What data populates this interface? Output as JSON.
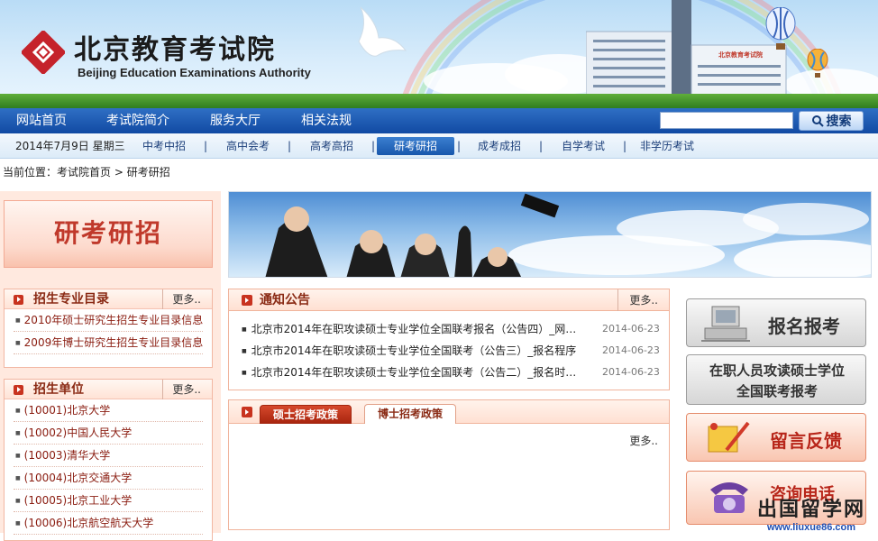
{
  "header": {
    "logo_cn": "北京教育考试院",
    "logo_en": "Beijing Education Examinations Authority",
    "building_sign": "北京教育考试院"
  },
  "main_nav": {
    "items": [
      "网站首页",
      "考试院简介",
      "服务大厅",
      "相关法规"
    ],
    "search_placeholder": "",
    "search_label": "搜索"
  },
  "sub_nav": {
    "date": "2014年7月9日 星期三",
    "items": [
      "中考中招",
      "高中会考",
      "高考高招",
      "研考研招",
      "成考成招",
      "自学考试",
      "非学历考试"
    ],
    "active_index": 3,
    "separator": "|"
  },
  "breadcrumb": {
    "prefix": "当前位置：",
    "home": "考试院首页",
    "sep": ">",
    "current": "研考研招"
  },
  "left": {
    "section_title": "研考研招",
    "catalog": {
      "title": "招生专业目录",
      "more": "更多..",
      "items": [
        "2010年硕士研究生招生专业目录信息",
        "2009年博士研究生招生专业目录信息"
      ]
    },
    "units": {
      "title": "招生单位",
      "more": "更多..",
      "items": [
        "(10001)北京大学",
        "(10002)中国人民大学",
        "(10003)清华大学",
        "(10004)北京交通大学",
        "(10005)北京工业大学",
        "(10006)北京航空航天大学"
      ]
    }
  },
  "notices": {
    "title": "通知公告",
    "more": "更多..",
    "items": [
      {
        "text": "北京市2014年在职攻读硕士专业学位全国联考报名（公告四）_网…",
        "date": "2014-06-23"
      },
      {
        "text": "北京市2014年在职攻读硕士专业学位全国联考（公告三）_报名程序",
        "date": "2014-06-23"
      },
      {
        "text": "北京市2014年在职攻读硕士专业学位全国联考（公告二）_报名时…",
        "date": "2014-06-23"
      }
    ]
  },
  "policy": {
    "tabs": [
      "硕士招考政策",
      "博士招考政策"
    ],
    "active_tab": 0,
    "more": "更多.."
  },
  "right": {
    "btn_signup": "报名报考",
    "btn_inservice_line1": "在职人员攻读硕士学位",
    "btn_inservice_line2": "全国联考报考",
    "btn_feedback": "留言反馈",
    "btn_hotline": "咨询电话"
  },
  "watermark": {
    "cn": "出国留学网",
    "url": "www.liuxue86.com"
  },
  "colors": {
    "nav_blue": "#1456ad",
    "accent_red": "#c8331f",
    "panel_pink": "#ffe9df"
  }
}
